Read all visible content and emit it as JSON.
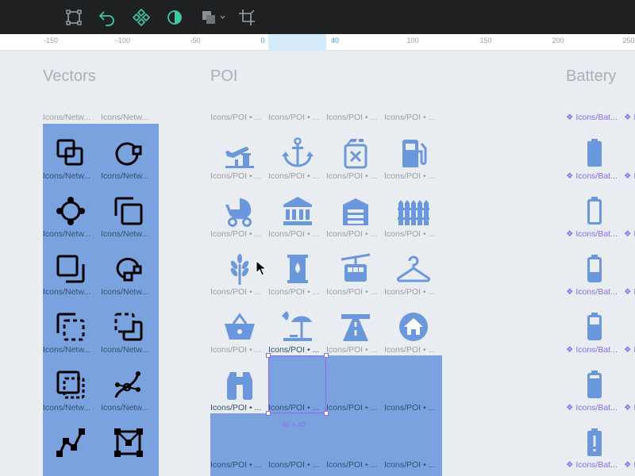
{
  "toolbar": {
    "icons": [
      "transform-icon",
      "flip-icon",
      "component-icon",
      "mask-icon",
      "boolean-icon",
      "crop-icon"
    ],
    "accent": "#3ec9a0"
  },
  "ruler": {
    "ticks": [
      "-150",
      "-100",
      "-50",
      "0",
      "40",
      "100",
      "150",
      "200",
      "250"
    ],
    "active_ticks": [
      "0",
      "40"
    ]
  },
  "sections": {
    "vectors": {
      "title": "Vectors",
      "caption": "Icons/Netw...",
      "icons": [
        "overlap-squares-icon",
        "circle-square-union-icon",
        "four-circles-union-icon",
        "square-front-icon",
        "square-behind-icon",
        "circle-union-icon",
        "dashed-square-front-icon",
        "dashed-square-behind-icon",
        "dashed-inner-square-icon",
        "curve-nodes-icon",
        "polyline-nodes-icon",
        "bounding-nodes-icon"
      ]
    },
    "poi": {
      "title": "POI",
      "caption": "Icons/POI • ...",
      "icons": [
        "airport-icon",
        "anchor-icon",
        "jerrycan-icon",
        "gas-station-icon",
        "stroller-icon",
        "bank-icon",
        "garage-icon",
        "fence-icon",
        "wheat-icon",
        "barrel-icon",
        "cable-car-icon",
        "hanger-icon",
        "basket-icon",
        "beach-icon",
        "highway-icon",
        "home-icon",
        "binoculars-icon"
      ],
      "selection": "40 × 40"
    },
    "battery": {
      "title": "Battery",
      "caption": "❖ Icons/Bat...",
      "caption_right": "❖ I",
      "icons": [
        "battery-full-icon",
        "battery-empty-icon",
        "battery-low-icon",
        "battery-mid-icon",
        "battery-high-icon",
        "battery-alert-icon"
      ]
    }
  },
  "colors": {
    "frame": "#7aa2df",
    "poi_icon": "#6b97dc",
    "selection": "#8b6cf0"
  }
}
